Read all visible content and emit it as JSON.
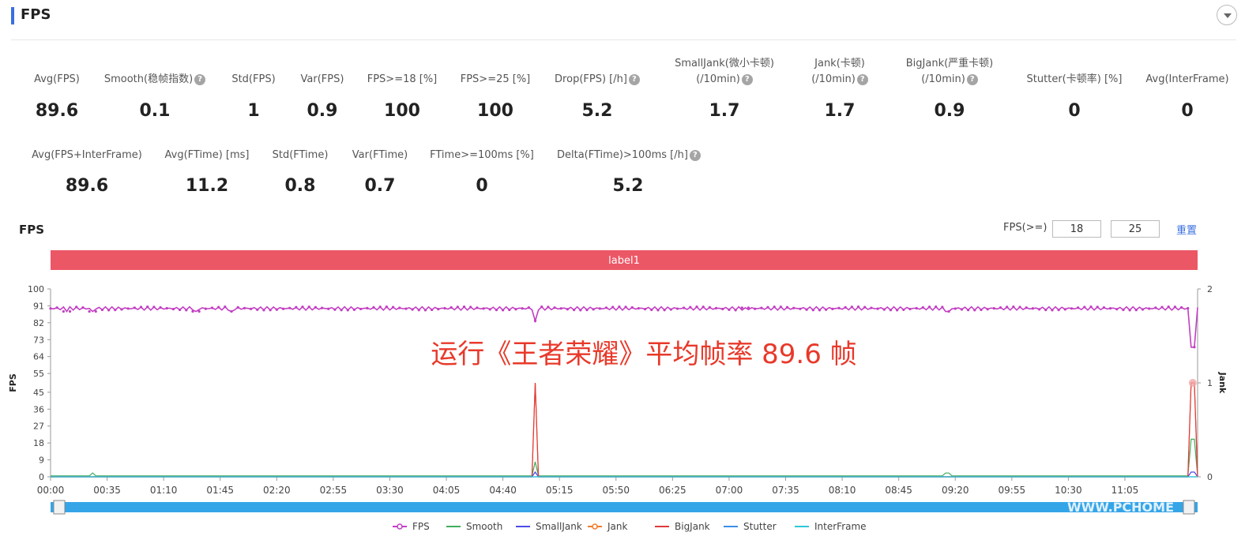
{
  "section": {
    "title": "FPS"
  },
  "metrics_row1": [
    {
      "label": "Avg(FPS)",
      "value": "89.6",
      "help": false
    },
    {
      "label": "Smooth(稳帧指数)",
      "value": "0.1",
      "help": true
    },
    {
      "label": "Std(FPS)",
      "value": "1",
      "help": false
    },
    {
      "label": "Var(FPS)",
      "value": "0.9",
      "help": false
    },
    {
      "label": "FPS>=18 [%]",
      "value": "100",
      "help": false
    },
    {
      "label": "FPS>=25 [%]",
      "value": "100",
      "help": false
    },
    {
      "label": "Drop(FPS) [/h]",
      "value": "5.2",
      "help": true
    },
    {
      "label": "SmallJank(微小卡顿)",
      "label2": "(/10min)",
      "value": "1.7",
      "help": true
    },
    {
      "label": "Jank(卡顿)",
      "label2": "(/10min)",
      "value": "1.7",
      "help": true
    },
    {
      "label": "BigJank(严重卡顿)",
      "label2": "(/10min)",
      "value": "0.9",
      "help": true
    },
    {
      "label": "Stutter(卡顿率) [%]",
      "value": "0",
      "help": false
    },
    {
      "label": "Avg(InterFrame)",
      "value": "0",
      "help": false
    }
  ],
  "metrics_row2": [
    {
      "label": "Avg(FPS+InterFrame)",
      "value": "89.6",
      "help": false
    },
    {
      "label": "Avg(FTime) [ms]",
      "value": "11.2",
      "help": false
    },
    {
      "label": "Std(FTime)",
      "value": "0.8",
      "help": false
    },
    {
      "label": "Var(FTime)",
      "value": "0.7",
      "help": false
    },
    {
      "label": "FTime>=100ms [%]",
      "value": "0",
      "help": false
    },
    {
      "label": "Delta(FTime)>100ms [/h]",
      "value": "5.2",
      "help": true
    }
  ],
  "chart_header": {
    "title": "FPS",
    "threshold_label": "FPS(>=)",
    "threshold_1": "18",
    "threshold_2": "25",
    "reset_label": "重置"
  },
  "chart_data": {
    "type": "line",
    "label_band": "label1",
    "overlay_text": "运行《王者荣耀》平均帧率 89.6 帧",
    "ylabel_left": "FPS",
    "ylabel_right": "Jank",
    "yticks_left": [
      0,
      9,
      18,
      27,
      36,
      45,
      55,
      64,
      73,
      82,
      91,
      100
    ],
    "yticks_right": [
      0,
      1,
      2
    ],
    "ylim_left": [
      0,
      100
    ],
    "ylim_right": [
      0,
      2
    ],
    "x_range_seconds": [
      0,
      710
    ],
    "xticks": [
      "00:00",
      "00:35",
      "01:10",
      "01:45",
      "02:20",
      "02:55",
      "03:30",
      "04:05",
      "04:40",
      "05:15",
      "05:50",
      "06:25",
      "07:00",
      "07:35",
      "08:10",
      "08:45",
      "09:20",
      "09:55",
      "10:30",
      "11:05"
    ],
    "series": [
      {
        "name": "FPS",
        "color": "#c23ec2",
        "axis": "left",
        "baseline": 89.6,
        "dips": [
          [
            10,
            88
          ],
          [
            26,
            88
          ],
          [
            90,
            88
          ],
          [
            112,
            88
          ],
          [
            300,
            83
          ],
          [
            430,
            90
          ],
          [
            555,
            88
          ],
          [
            707,
            69
          ]
        ]
      },
      {
        "name": "Smooth",
        "color": "#3fae5c",
        "axis": "left",
        "baseline": 0.5,
        "spikes": [
          [
            26,
            2
          ],
          [
            300,
            8
          ],
          [
            555,
            2
          ],
          [
            707,
            20
          ]
        ]
      },
      {
        "name": "SmallJank",
        "color": "#4a4ae8",
        "axis": "right",
        "baseline": 0,
        "spikes": [
          [
            300,
            0.05
          ],
          [
            707,
            0.05
          ]
        ]
      },
      {
        "name": "Jank",
        "color": "#f07c2a",
        "axis": "right",
        "baseline": 0,
        "spikes": [
          [
            300,
            1
          ],
          [
            707,
            1
          ]
        ]
      },
      {
        "name": "BigJank",
        "color": "#e03a3a",
        "axis": "right",
        "baseline": 0,
        "spikes": [
          [
            300,
            1
          ],
          [
            707,
            1
          ]
        ]
      },
      {
        "name": "Stutter",
        "color": "#3b8ee8",
        "axis": "right",
        "baseline": 0,
        "spikes": []
      },
      {
        "name": "InterFrame",
        "color": "#2ec7d8",
        "axis": "right",
        "baseline": 0,
        "spikes": []
      }
    ],
    "watermark": "WWW.PCHOME"
  },
  "colors": {
    "accent": "#3b6fe0",
    "label_band": "#ec5766",
    "slider": "#35a5e8"
  }
}
